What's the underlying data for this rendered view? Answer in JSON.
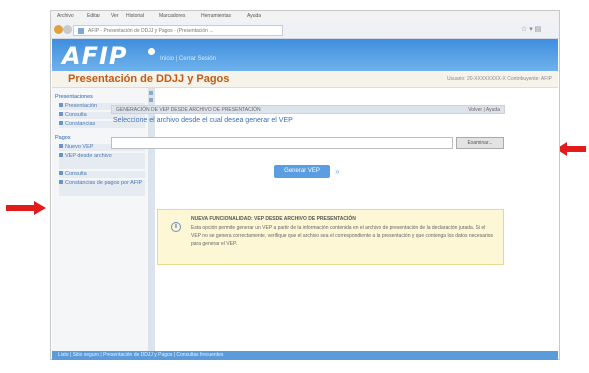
{
  "browser": {
    "menu_items": [
      "Archivo",
      "Editar",
      "Ver",
      "Historial",
      "Marcadores",
      "Herramientas",
      "Ayuda"
    ],
    "tab_title": "AFIP - Presentación de DDJJ y Pagos - (Presentación ...",
    "right_controls": "☆ ▾ ▤"
  },
  "banner": {
    "logo": "AFIP",
    "nav": "Inicio  |  Cerrar Sesión"
  },
  "page": {
    "title": "Presentación de DDJJ y Pagos",
    "user_info": "Usuario: 20-XXXXXXXX-X  Contribuyente: AFIP"
  },
  "sidebar": {
    "presentaciones_header": "Presentaciones",
    "presentaciones_items": [
      "Presentación",
      "Consulta",
      "Constancias"
    ],
    "pagos_header": "Pagos",
    "pagos_items": [
      "Nuevo VEP",
      "VEP desde archivo",
      "Consulta",
      "Constancias de pagos por AFIP"
    ]
  },
  "main": {
    "section_title": "GENERACIÓN DE VEP DESDE ARCHIVO DE PRESENTACIÓN",
    "section_help": "Volver | Ayuda",
    "instruction": "Seleccione el archivo desde el cual desea generar el VEP",
    "file_value": "",
    "browse_label": "Examinar...",
    "generate_label": "Generar VEP",
    "generate_arrow": "»"
  },
  "notice": {
    "icon": "i",
    "title": "NUEVA FUNCIONALIDAD: VEP DESDE ARCHIVO DE PRESENTACIÓN",
    "body": "Esta opción permite generar un VEP a partir de la información contenida en el archivo de presentación de la declaración jurada. Si el VEP no se genera correctamente, verifique que el archivo sea el correspondiente a la presentación y que contenga los datos necesarios para generar el VEP."
  },
  "status": {
    "text": "Listo  |  Sitio seguro  |  Presentación de DDJJ y Pagos  |  Consultas frecuentes"
  },
  "colors": {
    "annotation_arrow": "#e21b1b",
    "banner": "#3e8ede",
    "title": "#c55a11"
  }
}
